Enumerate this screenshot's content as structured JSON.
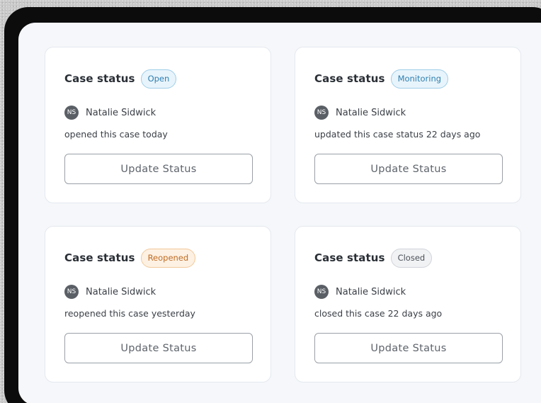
{
  "cards": [
    {
      "title": "Case status",
      "status": "Open",
      "user_initials": "NS",
      "user_name": "Natalie Sidwick",
      "activity": "opened this case today",
      "button_label": "Update Status"
    },
    {
      "title": "Case status",
      "status": "Monitoring",
      "user_initials": "NS",
      "user_name": "Natalie Sidwick",
      "activity": "updated this case status 22 days ago",
      "button_label": "Update Status"
    },
    {
      "title": "Case status",
      "status": "Reopened",
      "user_initials": "NS",
      "user_name": "Natalie Sidwick",
      "activity": "reopened this case yesterday",
      "button_label": "Update Status"
    },
    {
      "title": "Case status",
      "status": "Closed",
      "user_initials": "NS",
      "user_name": "Natalie Sidwick",
      "activity": "closed this case 22 days ago",
      "button_label": "Update Status"
    }
  ],
  "colors": {
    "open": "#2f7fb0",
    "monitoring": "#2f7fb0",
    "reopened": "#c06b22",
    "closed": "#4c5259",
    "avatar": "#5a5f66"
  }
}
